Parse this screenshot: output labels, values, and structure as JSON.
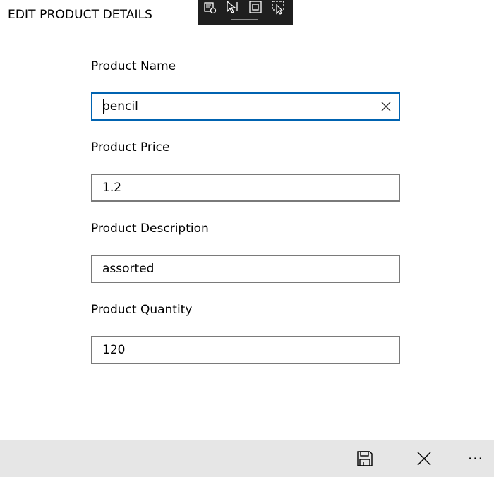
{
  "page": {
    "title": "EDIT PRODUCT DETAILS"
  },
  "debug_toolbar": {
    "tools": [
      "select-element-icon",
      "pointer-icon",
      "bounding-box-icon",
      "track-focus-icon"
    ]
  },
  "form": {
    "fields": [
      {
        "label": "Product Name",
        "value": "pencil",
        "focused": true
      },
      {
        "label": "Product Price",
        "value": "1.2",
        "focused": false
      },
      {
        "label": "Product Description",
        "value": "assorted",
        "focused": false
      },
      {
        "label": "Product Quantity",
        "value": "120",
        "focused": false
      }
    ]
  },
  "command_bar": {
    "buttons": [
      "save-icon",
      "close-icon",
      "more-icon"
    ],
    "more_label": "···"
  },
  "colors": {
    "focus_border": "#0063b1",
    "field_border": "#7a7a7a",
    "command_bar_bg": "#e6e6e6",
    "toolbar_bg": "#1f1f1f"
  }
}
